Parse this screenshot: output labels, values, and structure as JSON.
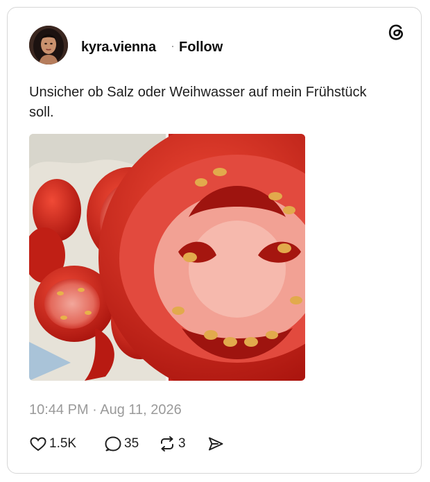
{
  "post": {
    "username": "kyra.vienna",
    "separator": "·",
    "follow_label": "Follow",
    "text": "Unsicher ob Salz oder Weihwasser auf mein Frühstück soll.",
    "timestamp": "10:44 PM · Aug 11, 2026"
  },
  "actions": {
    "likes": "1.5K",
    "replies": "35",
    "reposts": "3"
  },
  "icons": {
    "brand": "threads-logo-icon",
    "like": "heart-icon",
    "reply": "speech-bubble-icon",
    "repost": "repost-arrows-icon",
    "share": "send-arrow-icon"
  },
  "colors": {
    "text": "#101010",
    "muted": "#9a9a9a",
    "border": "#d6d6d6",
    "tomato": "#d8261c"
  }
}
